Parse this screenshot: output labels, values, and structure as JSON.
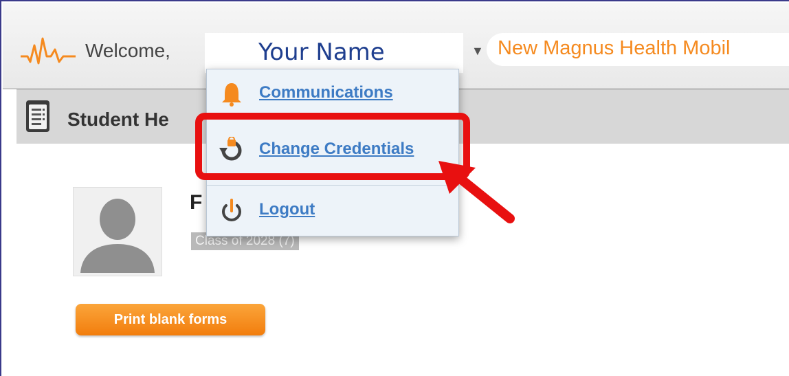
{
  "header": {
    "welcome_label": "Welcome,",
    "user_name": "Your Name",
    "app_link": "New Magnus Health Mobil"
  },
  "tab": {
    "title": "Student He"
  },
  "profile": {
    "name_initial": "F",
    "class_label": "Class of 2028 (7)"
  },
  "actions": {
    "print_label": "Print blank forms"
  },
  "user_menu": {
    "items": [
      {
        "label": "Communications",
        "icon": "bell-icon"
      },
      {
        "label": "Change Credentials",
        "icon": "refresh-lock-icon"
      },
      {
        "label": "Logout",
        "icon": "power-icon"
      }
    ]
  },
  "colors": {
    "accent_orange": "#f58a1f",
    "link_blue": "#3d7bc4",
    "name_blue": "#1f3f8f",
    "annotation_red": "#e81010"
  }
}
